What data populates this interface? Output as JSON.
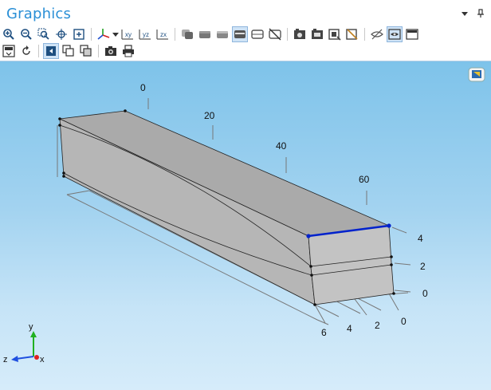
{
  "window": {
    "title": "Graphics",
    "controls": [
      "dropdown-icon",
      "pin-icon"
    ]
  },
  "toolbar_row1": [
    "zoom-in-icon",
    "zoom-out-icon",
    "zoom-box-icon",
    "zoom-selected-icon",
    "zoom-extents-icon",
    "separator",
    "view-axes-icon",
    "view-dropdown-icon",
    "view-xy-icon",
    "view-yz-icon",
    "view-zx-icon",
    "separator",
    "transparency-icon",
    "wireframe-icon",
    "render-icon",
    "select-boundaries-icon",
    "select-edges-icon",
    "clear-selection-icon",
    "separator",
    "image-snapshot-icon",
    "camera-icon",
    "capture-icon",
    "reset-icon",
    "separator",
    "hide-icon",
    "show-icon",
    "panel-icon"
  ],
  "toolbar_row2": [
    "grid-icon",
    "reset-view-icon",
    "separator",
    "lighting-icon",
    "copy-icon",
    "paste-icon",
    "separator",
    "photo-icon",
    "print-icon"
  ],
  "viewport": {
    "axis_top_ticks": [
      "0",
      "20",
      "40",
      "60"
    ],
    "axis_right_ticks": [
      "4",
      "2",
      "0"
    ],
    "axis_bottom_ticks": [
      "0",
      "2",
      "4",
      "6"
    ],
    "triad": {
      "x": "x",
      "y": "y",
      "z": "z"
    },
    "colors": {
      "background_top": "#7ec3ea",
      "background_bottom": "#d6ecfa",
      "body_top": "#aaaaaa",
      "body_side": "#b6b6b6",
      "body_front": "#c3c3c3",
      "selected_edge": "#0022cc",
      "grid": "#777777",
      "x_axis": "#e02020",
      "y_axis": "#20b020",
      "z_axis": "#2050e0"
    }
  }
}
